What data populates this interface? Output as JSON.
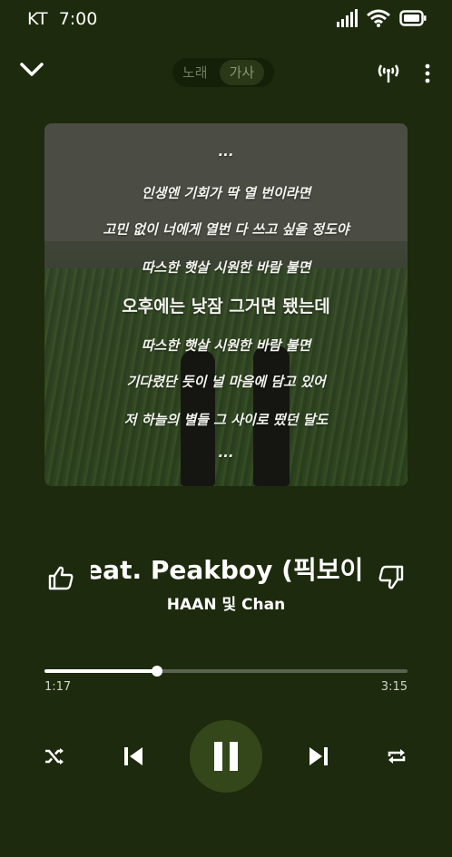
{
  "status_bar": {
    "carrier": "KT",
    "time": "7:00"
  },
  "topbar": {
    "tabs": [
      {
        "label": "노래",
        "active": false
      },
      {
        "label": "가사",
        "active": true
      }
    ]
  },
  "lyrics": {
    "lines": [
      "...",
      "인생엔 기회가 딱 열 번이라면",
      "고민 없이 너에게 열번 다 쓰고 싶을 정도야",
      "따스한 햇살 시원한 바람 불면",
      "오후에는 낮잠 그거면 됐는데",
      "따스한 햇살 시원한 바람 불면",
      "기다렸단 듯이 널 마음에 담고 있어",
      "저 하늘의 별들 그 사이로 떴던 달도",
      "..."
    ],
    "current_index": 4
  },
  "song": {
    "title": "feat. Peakboy (픽보이",
    "artist": "HAAN 및 Chan"
  },
  "progress": {
    "elapsed": "1:17",
    "duration": "3:15",
    "fraction": 0.31
  },
  "colors": {
    "background": "#1d2a0d",
    "play_button": "#34471a",
    "accent": "#ffffff"
  },
  "icons": {
    "collapse": "chevron-down-icon",
    "cast": "cast-icon",
    "more": "more-vertical-icon",
    "like": "thumbs-up-icon",
    "dislike": "thumbs-down-icon",
    "shuffle": "shuffle-icon",
    "previous": "skip-previous-icon",
    "pause": "pause-icon",
    "next": "skip-next-icon",
    "repeat": "repeat-icon"
  }
}
